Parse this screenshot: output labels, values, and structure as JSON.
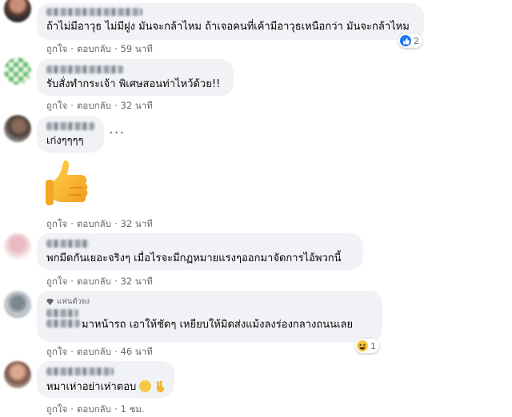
{
  "comments": [
    {
      "text": "ถ้าไม่มีอาวุธ ไม่มีฝูง มันจะกล้าไหม ถ้าเจอคนที่เค้ามีอาวุธเหนือกว่า มันจะกล้าไหม",
      "like": "ถูกใจ",
      "reply": "ตอบกลับ",
      "time": "59 นาที",
      "reaction_icon": "like-icon",
      "reaction_count": "2"
    },
    {
      "text": "รับสั่งทำกระเจ้า พิเศษสอนท่าไหว้ด้วย!!",
      "like": "ถูกใจ",
      "reply": "ตอบกลับ",
      "time": "32 นาที"
    },
    {
      "text": "เก่งๆๆๆๆ",
      "like": "ถูกใจ",
      "reply": "ตอบกลับ",
      "time": "32 นาที",
      "more": "···",
      "sticker": "thumbs-up-icon"
    },
    {
      "text": "พกมีดกันเยอะจริงๆ เมื่อไรจะมีกฏหมายแรงๆออกมาจัดการไอ้พวกนี้",
      "like": "ถูกใจ",
      "reply": "ตอบกลับ",
      "time": "32 นาที"
    },
    {
      "badge": "แฟนตัวยง",
      "text": "มาหน้ารถ เอาให้ชัดๆ เหยียบให้มิดส่งแม้งลงร่องกลางถนนเลย",
      "like": "ถูกใจ",
      "reply": "ตอบกลับ",
      "time": "46 นาที",
      "reaction_icon": "haha-icon",
      "reaction_count": "1"
    },
    {
      "text": "หมาเห่าอย่าเห่าตอบ",
      "like": "ถูกใจ",
      "reply": "ตอบกลับ",
      "time": "1 ชม."
    }
  ],
  "colors": {
    "bubble": "#f0f2f5",
    "meta_text": "#65676b",
    "like_blue": "#1877f2"
  }
}
